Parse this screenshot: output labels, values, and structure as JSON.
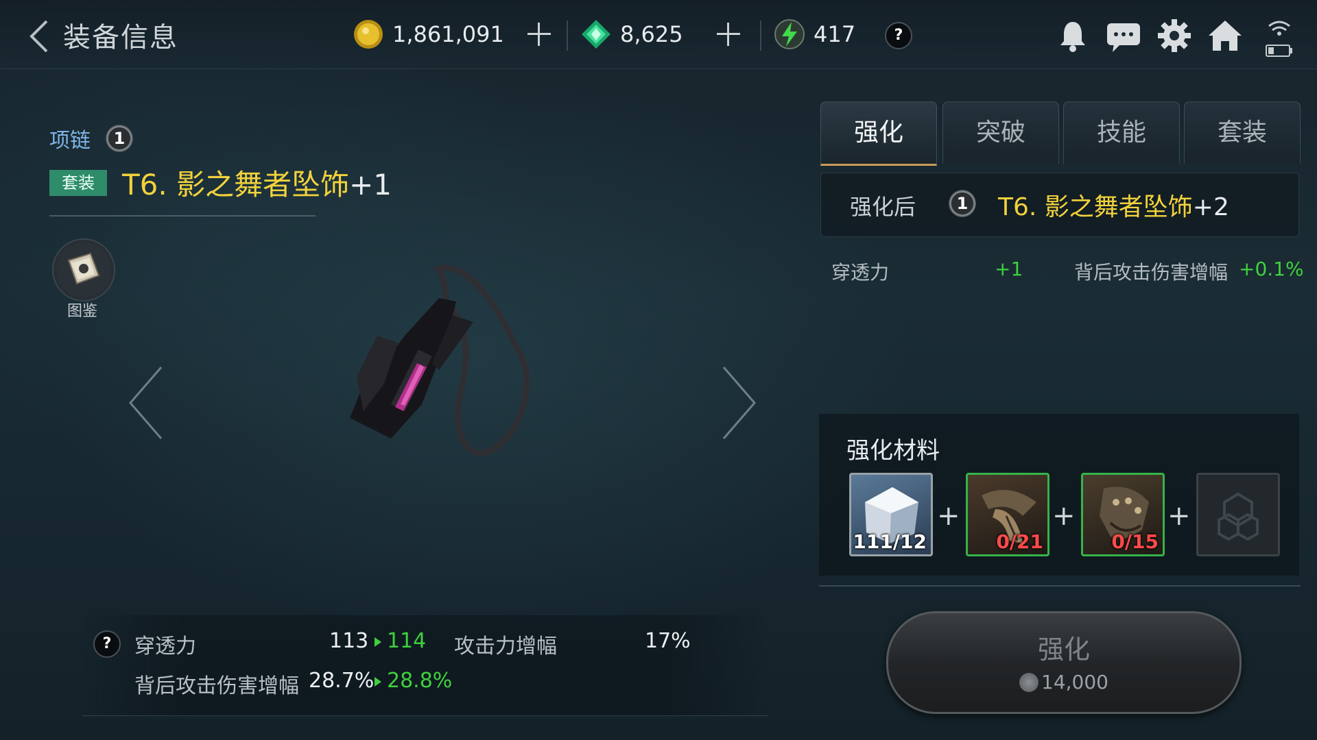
{
  "header": {
    "title": "装备信息",
    "gold": "1,861,091",
    "gems": "8,625",
    "energy": "417",
    "help": "?"
  },
  "item": {
    "slot": "项链",
    "tier_badge": "1",
    "set_tag": "套装",
    "name": "T6. 影之舞者坠饰",
    "level": "+1",
    "codex_label": "图鉴"
  },
  "stats": {
    "help": "?",
    "rows": [
      {
        "label": "穿透力",
        "current": "113",
        "next": "114"
      },
      {
        "label": "攻击力增幅",
        "current": "17%"
      },
      {
        "label": "背后攻击伤害增幅",
        "current": "28.7%",
        "next": "28.8%"
      }
    ]
  },
  "tabs": [
    "强化",
    "突破",
    "技能",
    "套装"
  ],
  "enhance": {
    "after_label": "强化后",
    "tier_badge": "1",
    "after_name": "T6. 影之舞者坠饰",
    "after_level": "+2",
    "bonus1_label": "穿透力",
    "bonus1_value": "+1",
    "bonus2_label": "背后攻击伤害增幅",
    "bonus2_value": "+0.1%",
    "materials_title": "强化材料",
    "materials": [
      {
        "icon": "crystal-ore-icon",
        "count": "111/12"
      },
      {
        "icon": "claw-fragment-icon",
        "count": "0/21"
      },
      {
        "icon": "gauntlet-fragment-icon",
        "count": "0/15"
      },
      {
        "icon": "empty-slot-icon",
        "count": ""
      }
    ],
    "plus": "+",
    "button_label": "强化",
    "cost": "14,000"
  },
  "colors": {
    "gold_text": "#f2d23c",
    "green_up": "#3ed23c",
    "set_tag": "#2f8c6a",
    "slot_label": "#7fb4e6",
    "red_count": "#ff4a4a"
  }
}
